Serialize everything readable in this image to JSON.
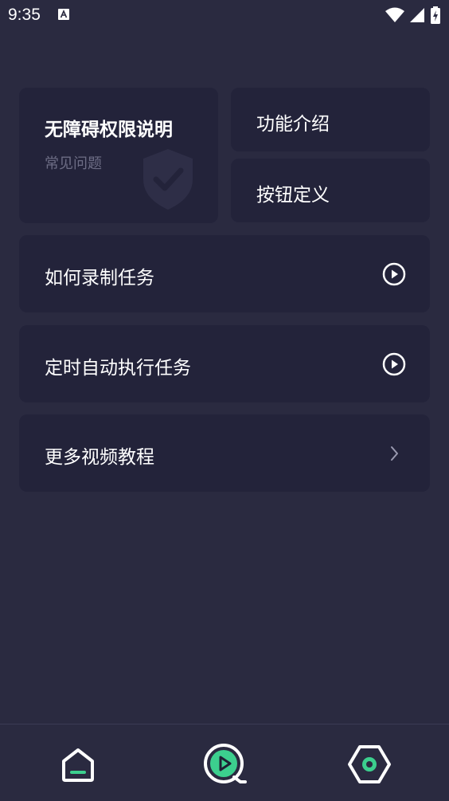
{
  "status_bar": {
    "time": "9:35",
    "icons": [
      "a-notification-icon",
      "wifi-icon",
      "signal-icon",
      "battery-charging-icon"
    ]
  },
  "cards": {
    "permissions": {
      "title": "无障碍权限说明",
      "subtitle": "常见问题",
      "icon": "shield-check-icon"
    },
    "intro": {
      "label": "功能介绍"
    },
    "buttons": {
      "label": "按钮定义"
    }
  },
  "rows": [
    {
      "label": "如何录制任务",
      "icon": "play-circle-icon"
    },
    {
      "label": "定时自动执行任务",
      "icon": "play-circle-icon"
    },
    {
      "label": "更多视频教程",
      "icon": "chevron-right-icon"
    }
  ],
  "bottom_nav": {
    "items": [
      {
        "icon": "home-icon"
      },
      {
        "icon": "play-search-icon",
        "active": true
      },
      {
        "icon": "hexagon-settings-icon"
      }
    ],
    "accent": "#3ccf8e"
  },
  "colors": {
    "background": "#2a2a40",
    "card": "#23233a",
    "muted_text": "#6d6d85"
  }
}
